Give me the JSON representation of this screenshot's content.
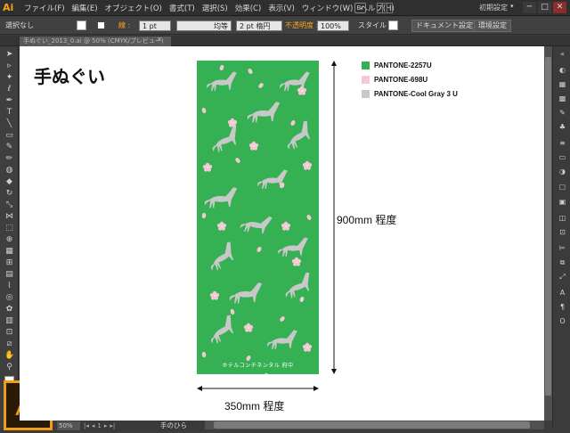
{
  "app": {
    "logo_small": "Ai",
    "logo_large": "Ai",
    "menus": [
      "ファイル(F)",
      "編集(E)",
      "オブジェクト(O)",
      "書式(T)",
      "選択(S)",
      "効果(C)",
      "表示(V)",
      "ウィンドウ(W)",
      "ヘルプ(H)"
    ],
    "bridge_label": "Br",
    "workspace": "初期設定",
    "workspace_arrow": "▾",
    "window_buttons": [
      "─",
      "□",
      "✕"
    ]
  },
  "control_bar": {
    "selection": "選択なし",
    "stroke_label": "線 :",
    "stroke_weight": "1 pt",
    "profile": "均等",
    "brush": "2 pt 楕円",
    "opacity_label": "不透明度 :",
    "opacity_value": "100%",
    "style_label": "スタイル :",
    "doc_setup_button": "ドキュメント設定",
    "prefs_button": "環境設定"
  },
  "document_tab": {
    "title": "手ぬぐい_2013_0.ai @ 50% (CMYK/プレビュー)",
    "close": "×"
  },
  "canvas": {
    "title": "手ぬぐい",
    "towel_text": "ホテルコンチネンタル 府中",
    "legend": [
      {
        "label": "PANTONE-2257U",
        "color": "#35b052"
      },
      {
        "label": "PANTONE-698U",
        "color": "#f6c8d6"
      },
      {
        "label": "PANTONE-Cool Gray 3 U",
        "color": "#c8c8c8"
      }
    ],
    "height_label": "900mm 程度",
    "width_label": "350mm 程度"
  },
  "status_bar": {
    "zoom": "50%",
    "page_nav": [
      "|◂",
      "◂",
      "1",
      "▸",
      "▸|"
    ],
    "tool_name": "手のひら"
  },
  "colors": {
    "towel_green": "#35b052",
    "blossom_pink": "#f6c8d6",
    "horse_gray": "#c8c8c8",
    "brand_orange": "#f29b15"
  }
}
